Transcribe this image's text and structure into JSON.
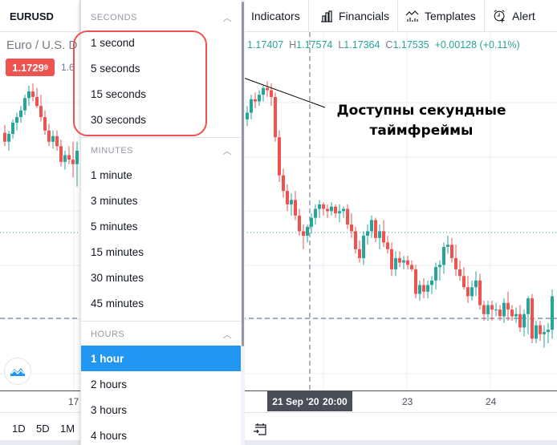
{
  "toolbar": {
    "symbol": "EURUSD",
    "indicators_label": "Indicators",
    "financials_label": "Financials",
    "templates_label": "Templates",
    "alert_label": "Alert"
  },
  "legend": {
    "title": "Euro / U.S. D",
    "open_value": "1.17407",
    "high_key": "H",
    "high_value": "1.17574",
    "low_key": "L",
    "low_value": "1.17364",
    "close_key": "C",
    "close_value": "1.17535",
    "change": "+0.00128 (+0.11%)"
  },
  "price_badge": {
    "main": "1.1729",
    "pip": "9",
    "next": "1.6"
  },
  "annotation": {
    "line1": "Доступны секундные",
    "line2": "таймфреймы"
  },
  "xaxis": {
    "ticks": [
      "17",
      "23",
      "24"
    ],
    "crosshair_date": "21 Sep '20",
    "crosshair_time": "20:00"
  },
  "bottom": {
    "ranges": [
      "1D",
      "5D",
      "1M"
    ]
  },
  "dropdown": {
    "sections": [
      {
        "header": "SECONDS",
        "items": [
          "1 second",
          "5 seconds",
          "15 seconds",
          "30 seconds"
        ]
      },
      {
        "header": "MINUTES",
        "items": [
          "1 minute",
          "3 minutes",
          "5 minutes",
          "15 minutes",
          "30 minutes",
          "45 minutes"
        ]
      },
      {
        "header": "HOURS",
        "items": [
          "1 hour",
          "2 hours",
          "3 hours",
          "4 hours"
        ]
      }
    ],
    "selected": "1 hour"
  },
  "colors": {
    "up": "#26a69a",
    "down": "#ef5350",
    "accent": "#2196f3",
    "highlight": "#f05050"
  },
  "candles": [
    [
      6,
      1.1688,
      1.1695,
      1.1676,
      1.168
    ],
    [
      11,
      1.168,
      1.169,
      1.1672,
      1.1687
    ],
    [
      16,
      1.1687,
      1.17,
      1.1683,
      1.1697
    ],
    [
      21,
      1.1697,
      1.1706,
      1.169,
      1.1702
    ],
    [
      26,
      1.1702,
      1.1712,
      1.1697,
      1.1708
    ],
    [
      31,
      1.1708,
      1.1722,
      1.1704,
      1.1719
    ],
    [
      36,
      1.1719,
      1.173,
      1.1712,
      1.1725
    ],
    [
      41,
      1.1725,
      1.1732,
      1.1716,
      1.172
    ],
    [
      46,
      1.172,
      1.1728,
      1.171,
      1.1712
    ],
    [
      51,
      1.1712,
      1.1722,
      1.1698,
      1.1702
    ],
    [
      56,
      1.1702,
      1.1708,
      1.1686,
      1.169
    ],
    [
      61,
      1.169,
      1.1696,
      1.1676,
      1.168
    ],
    [
      66,
      1.168,
      1.169,
      1.1674,
      1.1685
    ],
    [
      71,
      1.1685,
      1.169,
      1.1672,
      1.1676
    ],
    [
      76,
      1.1676,
      1.1682,
      1.1658,
      1.1662
    ],
    [
      81,
      1.1662,
      1.1672,
      1.1655,
      1.1668
    ],
    [
      86,
      1.1668,
      1.1676,
      1.166,
      1.1664
    ],
    [
      91,
      1.1664,
      1.168,
      1.1648,
      1.166
    ],
    [
      96,
      1.166,
      1.168,
      1.164,
      1.1672
    ],
    [
      308,
      1.17,
      1.1712,
      1.1694,
      1.1706
    ],
    [
      313,
      1.1706,
      1.1722,
      1.17,
      1.1718
    ],
    [
      318,
      1.1718,
      1.1724,
      1.171,
      1.1716
    ],
    [
      323,
      1.1716,
      1.1726,
      1.1712,
      1.1722
    ],
    [
      328,
      1.1722,
      1.173,
      1.1716,
      1.1728
    ],
    [
      333,
      1.1728,
      1.1734,
      1.172,
      1.1726
    ],
    [
      338,
      1.1726,
      1.1732,
      1.1712,
      1.172
    ],
    [
      343,
      1.172,
      1.1724,
      1.168,
      1.1684
    ],
    [
      348,
      1.1684,
      1.169,
      1.1644,
      1.165
    ],
    [
      353,
      1.165,
      1.1656,
      1.163,
      1.1636
    ],
    [
      358,
      1.1636,
      1.1642,
      1.1618,
      1.1624
    ],
    [
      363,
      1.1624,
      1.1634,
      1.1614,
      1.1628
    ],
    [
      368,
      1.1628,
      1.1636,
      1.161,
      1.1614
    ],
    [
      373,
      1.1614,
      1.162,
      1.1596,
      1.16
    ],
    [
      378,
      1.16,
      1.1606,
      1.1584,
      1.1596
    ],
    [
      383,
      1.1596,
      1.1606,
      1.159,
      1.1604
    ],
    [
      388,
      1.1604,
      1.1616,
      1.1598,
      1.1612
    ],
    [
      393,
      1.1612,
      1.1624,
      1.1606,
      1.162
    ],
    [
      398,
      1.162,
      1.1628,
      1.1612,
      1.1624
    ],
    [
      403,
      1.1624,
      1.1626,
      1.1614,
      1.162
    ],
    [
      408,
      1.162,
      1.1624,
      1.1612,
      1.1618
    ],
    [
      413,
      1.1618,
      1.1626,
      1.1614,
      1.1622
    ],
    [
      418,
      1.1622,
      1.1624,
      1.1612,
      1.1616
    ],
    [
      423,
      1.1616,
      1.1624,
      1.1608,
      1.1618
    ],
    [
      428,
      1.1618,
      1.1622,
      1.1612,
      1.162
    ],
    [
      433,
      1.162,
      1.1624,
      1.1602,
      1.1606
    ],
    [
      438,
      1.1606,
      1.1616,
      1.1594,
      1.16
    ],
    [
      443,
      1.16,
      1.1604,
      1.158,
      1.1584
    ],
    [
      448,
      1.1584,
      1.1592,
      1.1572,
      1.1576
    ],
    [
      453,
      1.1576,
      1.16,
      1.157,
      1.1596
    ],
    [
      458,
      1.1596,
      1.1606,
      1.1588,
      1.16
    ],
    [
      463,
      1.16,
      1.1614,
      1.1594,
      1.161
    ],
    [
      468,
      1.161,
      1.1612,
      1.159,
      1.1594
    ],
    [
      473,
      1.1594,
      1.1606,
      1.1584,
      1.16
    ],
    [
      478,
      1.16,
      1.161,
      1.1586,
      1.159
    ],
    [
      483,
      1.159,
      1.1596,
      1.158,
      1.1584
    ],
    [
      488,
      1.1584,
      1.159,
      1.156,
      1.1566
    ],
    [
      493,
      1.1566,
      1.1582,
      1.156,
      1.1576
    ],
    [
      498,
      1.1576,
      1.1582,
      1.1568,
      1.1572
    ],
    [
      503,
      1.1572,
      1.1578,
      1.1566,
      1.1574
    ],
    [
      508,
      1.1574,
      1.1578,
      1.1566,
      1.157
    ],
    [
      513,
      1.157,
      1.1574,
      1.1564,
      1.1566
    ],
    [
      518,
      1.1566,
      1.157,
      1.154,
      1.1544
    ],
    [
      523,
      1.1544,
      1.1556,
      1.1538,
      1.1552
    ],
    [
      528,
      1.1552,
      1.1558,
      1.154,
      1.1546
    ],
    [
      533,
      1.1546,
      1.1556,
      1.154,
      1.1552
    ],
    [
      538,
      1.1552,
      1.156,
      1.1544,
      1.1556
    ],
    [
      543,
      1.1556,
      1.1572,
      1.1548,
      1.1568
    ],
    [
      548,
      1.1568,
      1.1574,
      1.1556,
      1.157
    ],
    [
      553,
      1.157,
      1.159,
      1.1562,
      1.1586
    ],
    [
      558,
      1.1586,
      1.1596,
      1.158,
      1.1588
    ],
    [
      563,
      1.1588,
      1.1594,
      1.1572,
      1.1576
    ],
    [
      568,
      1.1576,
      1.1588,
      1.156,
      1.1566
    ],
    [
      573,
      1.1566,
      1.1574,
      1.1556,
      1.156
    ],
    [
      578,
      1.156,
      1.1568,
      1.1548,
      1.155
    ],
    [
      583,
      1.155,
      1.156,
      1.1536,
      1.1542
    ],
    [
      588,
      1.1542,
      1.1556,
      1.1538,
      1.155
    ],
    [
      593,
      1.155,
      1.1564,
      1.1542,
      1.1556
    ],
    [
      598,
      1.1556,
      1.1562,
      1.153,
      1.1534
    ],
    [
      603,
      1.1534,
      1.1538,
      1.152,
      1.1526
    ],
    [
      608,
      1.1526,
      1.1538,
      1.152,
      1.1534
    ],
    [
      613,
      1.1534,
      1.1538,
      1.152,
      1.153
    ],
    [
      618,
      1.153,
      1.1536,
      1.1524,
      1.153
    ],
    [
      623,
      1.153,
      1.1534,
      1.152,
      1.1524
    ],
    [
      628,
      1.1524,
      1.154,
      1.1518,
      1.1536
    ],
    [
      633,
      1.1536,
      1.1546,
      1.152,
      1.153
    ],
    [
      638,
      1.153,
      1.1534,
      1.152,
      1.1524
    ],
    [
      643,
      1.1524,
      1.1532,
      1.1518,
      1.1526
    ],
    [
      648,
      1.1526,
      1.1534,
      1.151,
      1.1514
    ],
    [
      653,
      1.1514,
      1.153,
      1.1506,
      1.1526
    ],
    [
      658,
      1.1526,
      1.1542,
      1.1508,
      1.154
    ],
    [
      663,
      1.154,
      1.1544,
      1.15,
      1.1504
    ],
    [
      668,
      1.1504,
      1.152,
      1.15,
      1.1516
    ],
    [
      673,
      1.1516,
      1.152,
      1.1502,
      1.1508
    ],
    [
      678,
      1.1508,
      1.1516,
      1.1496,
      1.151
    ],
    [
      683,
      1.151,
      1.1518,
      1.15,
      1.1512
    ],
    [
      688,
      1.1512,
      1.1548,
      1.1504,
      1.1542
    ]
  ]
}
